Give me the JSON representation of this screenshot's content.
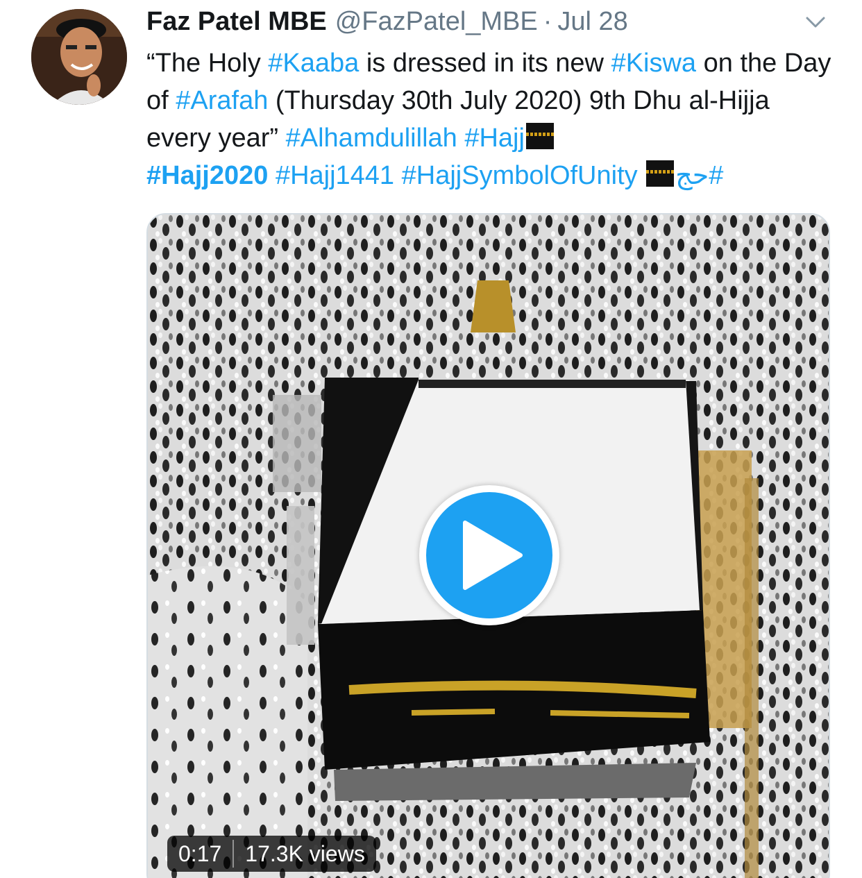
{
  "tweet": {
    "display_name": "Faz Patel MBE",
    "handle": "@FazPatel_MBE",
    "separator": "·",
    "date": "Jul 28",
    "text_segments": [
      {
        "t": "“The Holy ",
        "tag": false
      },
      {
        "t": "#Kaaba",
        "tag": true
      },
      {
        "t": " is dressed in its new ",
        "tag": false
      },
      {
        "t": "#Kiswa",
        "tag": true
      },
      {
        "t": " on the Day of ",
        "tag": false
      },
      {
        "t": "#Arafah",
        "tag": true
      },
      {
        "t": " (Thursday 30th July 2020) 9th Dhu al-Hijja every year” ",
        "tag": false
      },
      {
        "t": "#Alhamdulillah",
        "tag": true
      },
      {
        "t": " ",
        "tag": false
      },
      {
        "t": "#Hajj",
        "tag": true
      }
    ],
    "line4": {
      "tag1": "#Hajj2020",
      "tag2": "#Hajj1441",
      "tag3": "#HajjSymbolOfUnity",
      "tag4": "#حج"
    }
  },
  "media": {
    "duration": "0:17",
    "views": "17.3K views"
  },
  "icons": {
    "caret": "chevron-down-icon",
    "play": "play-icon",
    "emoji": "kaaba-emoji-icon"
  },
  "colors": {
    "link": "#1da1f2",
    "muted": "#657786",
    "text": "#14171a"
  }
}
